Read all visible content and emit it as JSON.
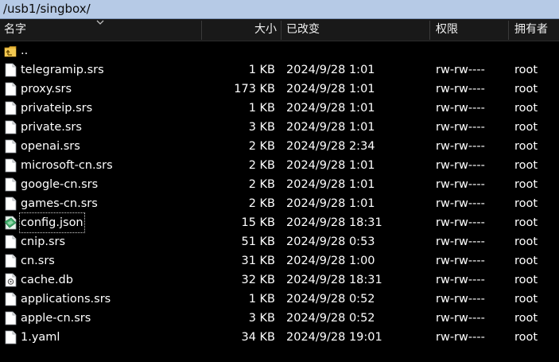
{
  "path": "/usb1/singbox/",
  "columns": {
    "name": "名字",
    "size": "大小",
    "modified": "已改变",
    "permissions": "权限",
    "owner": "拥有者"
  },
  "colors": {
    "path_bar_bg": "#b6cae6",
    "background": "#000000",
    "header_bg": "#191919",
    "folder": "#e8b83c",
    "json_icon": "#3fae6a"
  },
  "parent_dir": {
    "name": "..",
    "icon": "parent-folder-icon"
  },
  "files": [
    {
      "name": "telegramip.srs",
      "size": "1 KB",
      "modified": "2024/9/28 1:01",
      "permissions": "rw-rw----",
      "owner": "root",
      "icon": "file-icon"
    },
    {
      "name": "proxy.srs",
      "size": "173 KB",
      "modified": "2024/9/28 1:01",
      "permissions": "rw-rw----",
      "owner": "root",
      "icon": "file-icon"
    },
    {
      "name": "privateip.srs",
      "size": "1 KB",
      "modified": "2024/9/28 1:01",
      "permissions": "rw-rw----",
      "owner": "root",
      "icon": "file-icon"
    },
    {
      "name": "private.srs",
      "size": "3 KB",
      "modified": "2024/9/28 1:01",
      "permissions": "rw-rw----",
      "owner": "root",
      "icon": "file-icon"
    },
    {
      "name": "openai.srs",
      "size": "2 KB",
      "modified": "2024/9/28 2:34",
      "permissions": "rw-rw----",
      "owner": "root",
      "icon": "file-icon"
    },
    {
      "name": "microsoft-cn.srs",
      "size": "2 KB",
      "modified": "2024/9/28 1:01",
      "permissions": "rw-rw----",
      "owner": "root",
      "icon": "file-icon"
    },
    {
      "name": "google-cn.srs",
      "size": "2 KB",
      "modified": "2024/9/28 1:01",
      "permissions": "rw-rw----",
      "owner": "root",
      "icon": "file-icon"
    },
    {
      "name": "games-cn.srs",
      "size": "2 KB",
      "modified": "2024/9/28 1:01",
      "permissions": "rw-rw----",
      "owner": "root",
      "icon": "file-icon"
    },
    {
      "name": "config.json",
      "size": "15 KB",
      "modified": "2024/9/28 18:31",
      "permissions": "rw-rw----",
      "owner": "root",
      "icon": "json-file-icon",
      "focused": true
    },
    {
      "name": "cnip.srs",
      "size": "51 KB",
      "modified": "2024/9/28 0:53",
      "permissions": "rw-rw----",
      "owner": "root",
      "icon": "file-icon"
    },
    {
      "name": "cn.srs",
      "size": "31 KB",
      "modified": "2024/9/28 1:00",
      "permissions": "rw-rw----",
      "owner": "root",
      "icon": "file-icon"
    },
    {
      "name": "cache.db",
      "size": "32 KB",
      "modified": "2024/9/28 18:31",
      "permissions": "rw-rw----",
      "owner": "root",
      "icon": "database-file-icon"
    },
    {
      "name": "applications.srs",
      "size": "1 KB",
      "modified": "2024/9/28 0:52",
      "permissions": "rw-rw----",
      "owner": "root",
      "icon": "file-icon"
    },
    {
      "name": "apple-cn.srs",
      "size": "3 KB",
      "modified": "2024/9/28 0:52",
      "permissions": "rw-rw----",
      "owner": "root",
      "icon": "file-icon"
    },
    {
      "name": "1.yaml",
      "size": "34 KB",
      "modified": "2024/9/28 19:01",
      "permissions": "rw-rw----",
      "owner": "root",
      "icon": "file-icon"
    }
  ]
}
